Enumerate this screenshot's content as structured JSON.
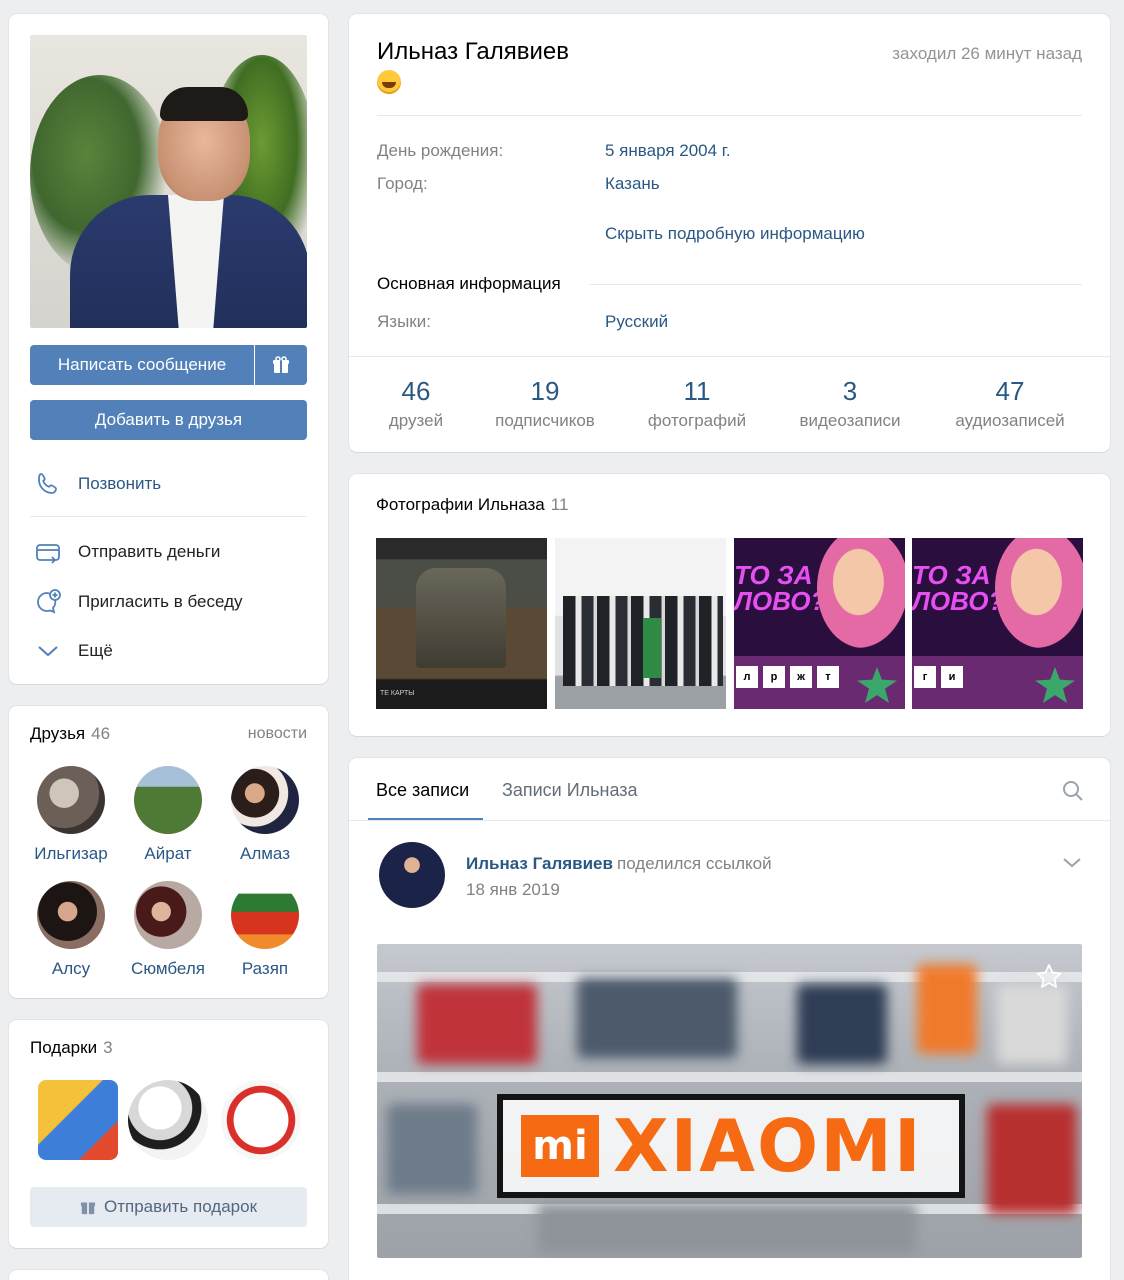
{
  "profile": {
    "name": "Ильназ Галявиев",
    "last_seen": "заходил 26 минут назад",
    "info": [
      {
        "label": "День рождения:",
        "value": "5 января 2004 г."
      },
      {
        "label": "Город:",
        "value": "Казань"
      }
    ],
    "hide_details_link": "Скрыть подробную информацию",
    "main_info_title": "Основная информация",
    "languages_label": "Языки:",
    "languages_value": "Русский"
  },
  "counters": [
    {
      "num": "46",
      "label": "друзей"
    },
    {
      "num": "19",
      "label": "подписчиков"
    },
    {
      "num": "11",
      "label": "фотографий"
    },
    {
      "num": "3",
      "label": "видеозаписи"
    },
    {
      "num": "47",
      "label": "аудиозаписей"
    }
  ],
  "actions": {
    "message_button": "Написать сообщение",
    "add_friend_button": "Добавить в друзья",
    "menu": [
      {
        "label": "Позвонить",
        "icon": "phone-icon"
      },
      {
        "label": "Отправить деньги",
        "icon": "wallet-icon"
      },
      {
        "label": "Пригласить в беседу",
        "icon": "chat-add-icon"
      },
      {
        "label": "Ещё",
        "icon": "chevron-down-icon"
      }
    ]
  },
  "friends": {
    "title": "Друзья",
    "count": "46",
    "link": "новости",
    "items": [
      {
        "name": "Ильгизар"
      },
      {
        "name": "Айрат"
      },
      {
        "name": "Алмаз"
      },
      {
        "name": "Алсу"
      },
      {
        "name": "Сюмбеля"
      },
      {
        "name": "Разяп"
      }
    ]
  },
  "gifts": {
    "title": "Подарки",
    "count": "3",
    "send_button": "Отправить подарок"
  },
  "photos": {
    "title": "Фотографии Ильназа",
    "count": "11",
    "thumb_text": {
      "quiz_line1": "ТО ЗА",
      "quiz_line2": "ЛОВО?",
      "letters_a": [
        "л",
        "р",
        "ж",
        "т"
      ],
      "letters_b": [
        "г",
        "и"
      ],
      "game_caption": "ТЕ КАРТЫ"
    }
  },
  "wall": {
    "tabs": [
      "Все записи",
      "Записи Ильназа"
    ],
    "post": {
      "author": "Ильназ Галявиев",
      "action": "поделился ссылкой",
      "date": "18 янв 2019",
      "image_brand_mi": "mi",
      "image_brand_word": "XIAOMI"
    }
  },
  "colors": {
    "accent": "#5181b8",
    "link": "#2a5885",
    "muted": "#828282",
    "background": "#edeef0"
  }
}
